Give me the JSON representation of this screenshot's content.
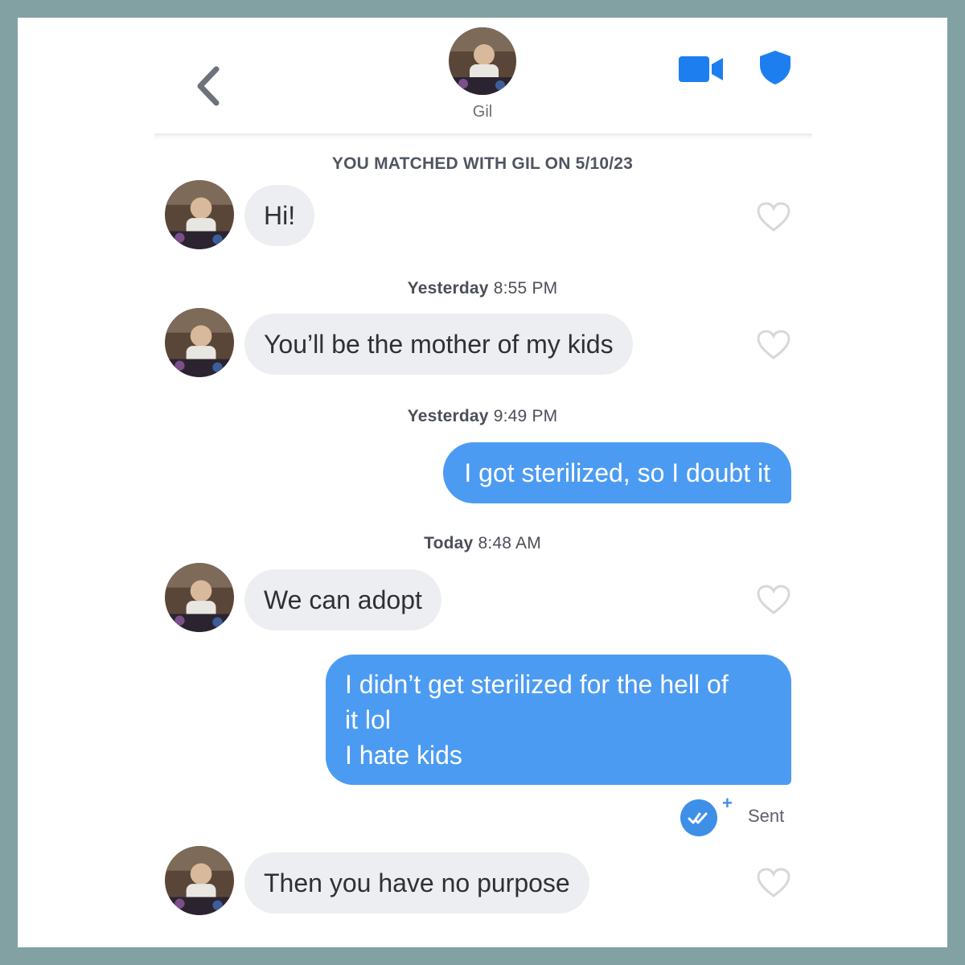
{
  "header": {
    "name": "Gil",
    "icons": {
      "back": "chevron-left-icon",
      "video": "video-camera-icon",
      "safety": "shield-icon"
    },
    "accent_color": "#1d7ef0"
  },
  "match_notice": "YOU MATCHED WITH GIL ON 5/10/23",
  "timestamps": [
    {
      "day": "Yesterday",
      "time": "8:55 PM"
    },
    {
      "day": "Yesterday",
      "time": "9:49 PM"
    },
    {
      "day": "Today",
      "time": "8:48 AM"
    }
  ],
  "messages": [
    {
      "from": "Gil",
      "text": "Hi!"
    },
    {
      "from": "Gil",
      "text": "You’ll be the mother of my kids"
    },
    {
      "from": "me",
      "text": "I got sterilized, so I doubt it"
    },
    {
      "from": "Gil",
      "text": "We can adopt"
    },
    {
      "from": "me",
      "lines": [
        "I didn’t get sterilized for the hell of",
        "it lol",
        "I hate kids"
      ]
    },
    {
      "from": "Gil",
      "text": "Then you have no purpose"
    }
  ],
  "delivery_status": {
    "label": "Sent",
    "plus": "+"
  },
  "colors": {
    "incoming_bubble": "#eceef1",
    "outgoing_bubble": "#4c9bf2",
    "frame": "#82a1a3"
  }
}
